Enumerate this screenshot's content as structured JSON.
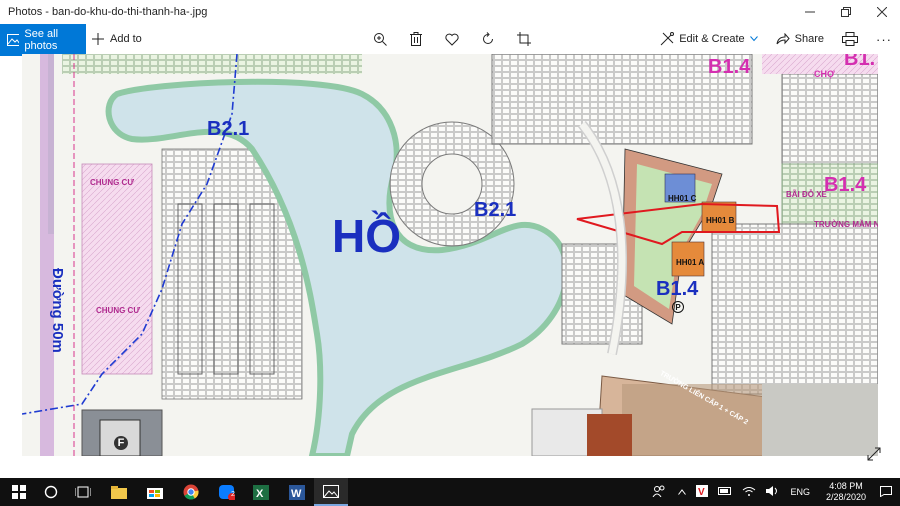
{
  "window": {
    "title": "Photos - ban-do-khu-do-thi-thanh-ha-.jpg",
    "controls": [
      "minimize",
      "maximize",
      "close"
    ]
  },
  "toolbar": {
    "see_all": "See all photos",
    "add_to": "Add to",
    "center_icons": [
      "zoom-icon",
      "delete-icon",
      "heart-icon",
      "rotate-icon",
      "crop-icon"
    ],
    "edit_create": "Edit & Create",
    "share": "Share",
    "print_icon": "print-icon",
    "more": "···"
  },
  "map": {
    "lake_label": "HỒ",
    "zone_b21_a": "B2.1",
    "zone_b21_b": "B2.1",
    "zone_b14_a": "B1.4",
    "zone_b14_b": "B1.4",
    "zone_b14_c": "B1.4",
    "zone_b1_partial": "B1.",
    "cho": "CHỢ",
    "chung_cu_a": "CHUNG CƯ",
    "chung_cu_b": "CHUNG CƯ",
    "duong_50m": "Đường 50m",
    "bai_do_xe": "BÃI ĐỖ XE",
    "truong_mam_non": "TRƯỜNG MẦM NC",
    "hh01c": "HH01 C",
    "hh01b": "HH01 B",
    "hh01a": "HH01 A",
    "truong_lien_cap": "TRƯỜNG LIÊN CẤP 1 + CẤP 2",
    "f_label": "F",
    "p_label": "P"
  },
  "taskbar": {
    "apps": [
      "start-icon",
      "search-circle-icon",
      "task-view-icon",
      "file-explorer-icon",
      "store-icon",
      "chrome-icon",
      "zalo-icon",
      "excel-icon",
      "word-icon",
      "photos-icon"
    ],
    "zalo_badge": "2",
    "lang": "ENG",
    "time": "4:08 PM",
    "date": "2/28/2020"
  },
  "colors": {
    "accent": "#0078d7",
    "lake": "#cfe3ea",
    "green": "#cfe8c4",
    "pink": "#f3cfe8",
    "blue_label": "#1a2fbf",
    "magenta_label": "#d42fb0",
    "red_marker": "#e0191f"
  }
}
